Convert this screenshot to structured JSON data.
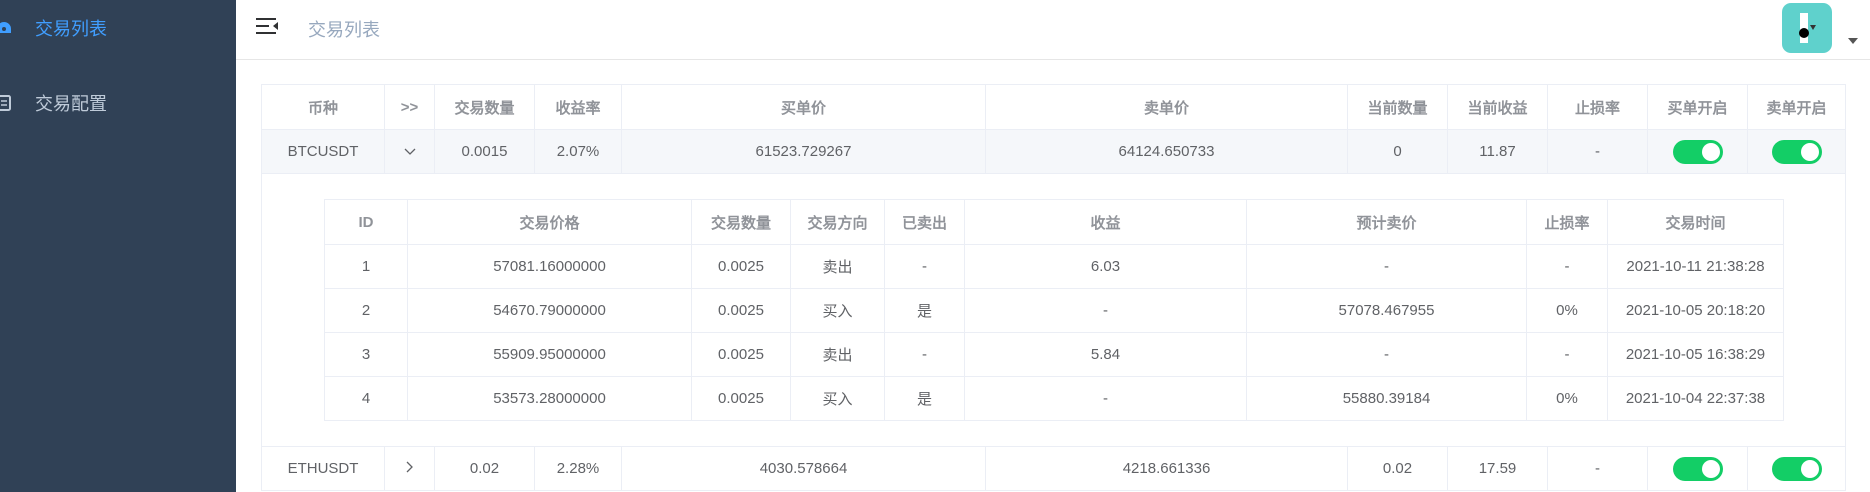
{
  "sidebar": {
    "items": [
      {
        "label": "交易列表",
        "icon": "dashboard-icon",
        "active": true
      },
      {
        "label": "交易配置",
        "icon": "document-icon",
        "active": false
      }
    ]
  },
  "header": {
    "breadcrumb": "交易列表"
  },
  "table": {
    "headers": [
      "币种",
      ">>",
      "交易数量",
      "收益率",
      "买单价",
      "卖单价",
      "当前数量",
      "当前收益",
      "止损率",
      "买单开启",
      "卖单开启"
    ],
    "rows": [
      {
        "coin": "BTCUSDT",
        "qty": "0.0015",
        "rate": "2.07%",
        "buy": "61523.729267",
        "sell": "64124.650733",
        "cur_qty": "0",
        "cur_profit": "11.87",
        "stop": "-",
        "buy_on": true,
        "sell_on": true,
        "expanded": true
      },
      {
        "coin": "ETHUSDT",
        "qty": "0.02",
        "rate": "2.28%",
        "buy": "4030.578664",
        "sell": "4218.661336",
        "cur_qty": "0.02",
        "cur_profit": "17.59",
        "stop": "-",
        "buy_on": true,
        "sell_on": true,
        "expanded": false
      }
    ]
  },
  "detail": {
    "headers": [
      "ID",
      "交易价格",
      "交易数量",
      "交易方向",
      "已卖出",
      "收益",
      "预计卖价",
      "止损率",
      "交易时间"
    ],
    "rows": [
      {
        "id": "1",
        "price": "57081.16000000",
        "qty": "0.0025",
        "dir": "卖出",
        "sold": "-",
        "profit": "6.03",
        "est": "-",
        "stop": "-",
        "time": "2021-10-11 21:38:28"
      },
      {
        "id": "2",
        "price": "54670.79000000",
        "qty": "0.0025",
        "dir": "买入",
        "sold": "是",
        "profit": "-",
        "est": "57078.467955",
        "stop": "0%",
        "time": "2021-10-05 20:18:20"
      },
      {
        "id": "3",
        "price": "55909.95000000",
        "qty": "0.0025",
        "dir": "卖出",
        "sold": "-",
        "profit": "5.84",
        "est": "-",
        "stop": "-",
        "time": "2021-10-05 16:38:29"
      },
      {
        "id": "4",
        "price": "53573.28000000",
        "qty": "0.0025",
        "dir": "买入",
        "sold": "是",
        "profit": "-",
        "est": "55880.39184",
        "stop": "0%",
        "time": "2021-10-04 22:37:38"
      }
    ]
  },
  "colors": {
    "sidebar_bg": "#304156",
    "active": "#409eff",
    "switch_on": "#13ce66",
    "sell": "#f01a1a",
    "buy": "#1a8f1a"
  }
}
